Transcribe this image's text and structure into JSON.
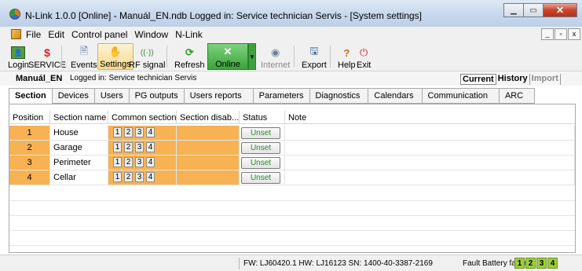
{
  "window": {
    "title": "N-Link 1.0.0 [Online] - Manuál_EN.ndb Logged in: Service technician Servis - [System settings]",
    "app_icon": "n-link-logo-icon"
  },
  "menu": {
    "items": [
      "File",
      "Edit",
      "Control panel",
      "Window",
      "N-Link"
    ]
  },
  "toolbar": {
    "buttons": [
      {
        "label": "Login",
        "icon": "login-icon"
      },
      {
        "label": "SERVICE",
        "icon": "service-icon"
      },
      {
        "label": "Events",
        "icon": "events-icon"
      },
      {
        "label": "Settings",
        "icon": "settings-icon"
      },
      {
        "label": "RF signal",
        "icon": "rf-signal-icon"
      },
      {
        "label": "Refresh",
        "icon": "refresh-icon"
      },
      {
        "label": "Online",
        "icon": "online-icon"
      },
      {
        "label": "Internet",
        "icon": "internet-icon"
      },
      {
        "label": "Export",
        "icon": "export-icon"
      },
      {
        "label": "Help",
        "icon": "help-icon"
      },
      {
        "label": "Exit",
        "icon": "exit-icon"
      }
    ]
  },
  "info": {
    "database": "Manuál_EN",
    "login": "Logged in: Service technician Servis",
    "view_tabs": [
      "Current",
      "History",
      "Import"
    ]
  },
  "tabs": [
    "Section",
    "Devices",
    "Users",
    "PG outputs",
    "Users reports",
    "Parameters",
    "Diagnostics",
    "Calendars",
    "Communication",
    "ARC"
  ],
  "table": {
    "columns": [
      "Position",
      "Section name",
      "Common section",
      "Section disab...",
      "Status",
      "Note"
    ],
    "rows": [
      {
        "position": "1",
        "name": "House",
        "common": [
          "1",
          "2",
          "3",
          "4"
        ],
        "status": "Unset"
      },
      {
        "position": "2",
        "name": "Garage",
        "common": [
          "1",
          "2",
          "3",
          "4"
        ],
        "status": "Unset"
      },
      {
        "position": "3",
        "name": "Perimeter",
        "common": [
          "1",
          "2",
          "3",
          "4"
        ],
        "status": "Unset"
      },
      {
        "position": "4",
        "name": "Cellar",
        "common": [
          "1",
          "2",
          "3",
          "4"
        ],
        "status": "Unset"
      }
    ]
  },
  "status": {
    "firmware": "FW: LJ60420.1 HW: LJ16123 SN: 1400-40-3387-2169",
    "fault": "Fault Battery failure",
    "sections": [
      "1",
      "2",
      "3",
      "4"
    ]
  },
  "colors": {
    "section_orange": "#f7b253",
    "online_green": "#3aa43a",
    "section_light_green": "#9ccf3b"
  }
}
